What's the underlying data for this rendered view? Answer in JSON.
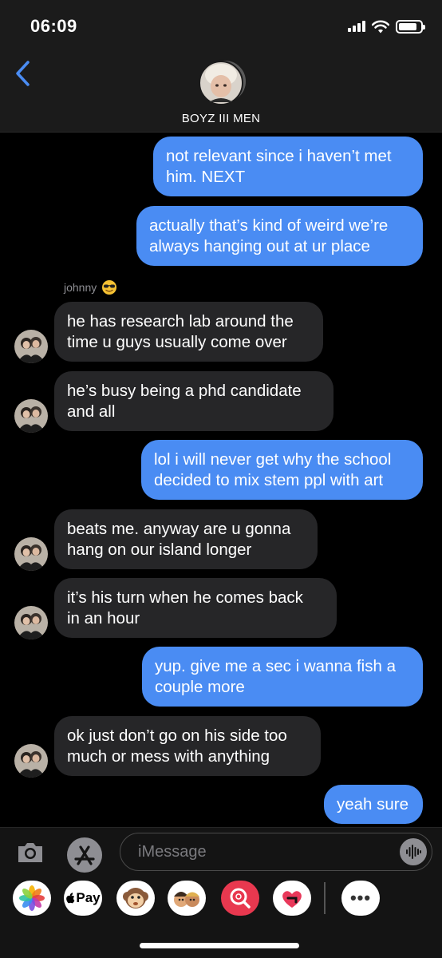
{
  "status_bar": {
    "time": "06:09",
    "battery_level": 0.85
  },
  "header": {
    "title": "BOYZ III MEN"
  },
  "sender": {
    "name": "johnny",
    "emoji": "smiling-face-with-sunglasses"
  },
  "messages": [
    {
      "direction": "sent",
      "lines": [
        "not relevant since i haven’t met",
        "him. NEXT"
      ]
    },
    {
      "direction": "sent",
      "lines": [
        "actually that’s kind of weird we’re",
        "always hanging out at ur place"
      ]
    },
    {
      "direction": "received",
      "lines": [
        "he has research lab around the",
        "time u guys usually come over"
      ]
    },
    {
      "direction": "received",
      "lines": [
        "he’s busy being a phd candidate",
        "and all"
      ]
    },
    {
      "direction": "sent",
      "lines": [
        "lol i will never get why the school",
        "decided to mix stem ppl with art"
      ]
    },
    {
      "direction": "received",
      "lines": [
        "beats me. anyway are u gonna",
        "hang on our island longer"
      ]
    },
    {
      "direction": "received",
      "lines": [
        "it’s his turn when he comes back",
        "in an hour"
      ]
    },
    {
      "direction": "sent",
      "lines": [
        "yup. give me a sec i wanna fish a",
        "couple more"
      ]
    },
    {
      "direction": "received",
      "lines": [
        "ok just don’t go on his side too",
        "much or mess with anything"
      ]
    },
    {
      "direction": "sent",
      "lines": [
        "yeah sure"
      ]
    }
  ],
  "composer": {
    "placeholder": "iMessage"
  },
  "app_drawer": {
    "apps": [
      "photos-icon",
      "apple-pay-icon",
      "animoji-icon",
      "memoji-icon",
      "image-search-icon",
      "digital-touch-icon"
    ],
    "apple_pay_label": "Pay",
    "more_label": "•••"
  },
  "colors": {
    "sent_bubble": "#4a8cf3",
    "received_bubble": "#262628",
    "accent": "#4a8cf3"
  }
}
